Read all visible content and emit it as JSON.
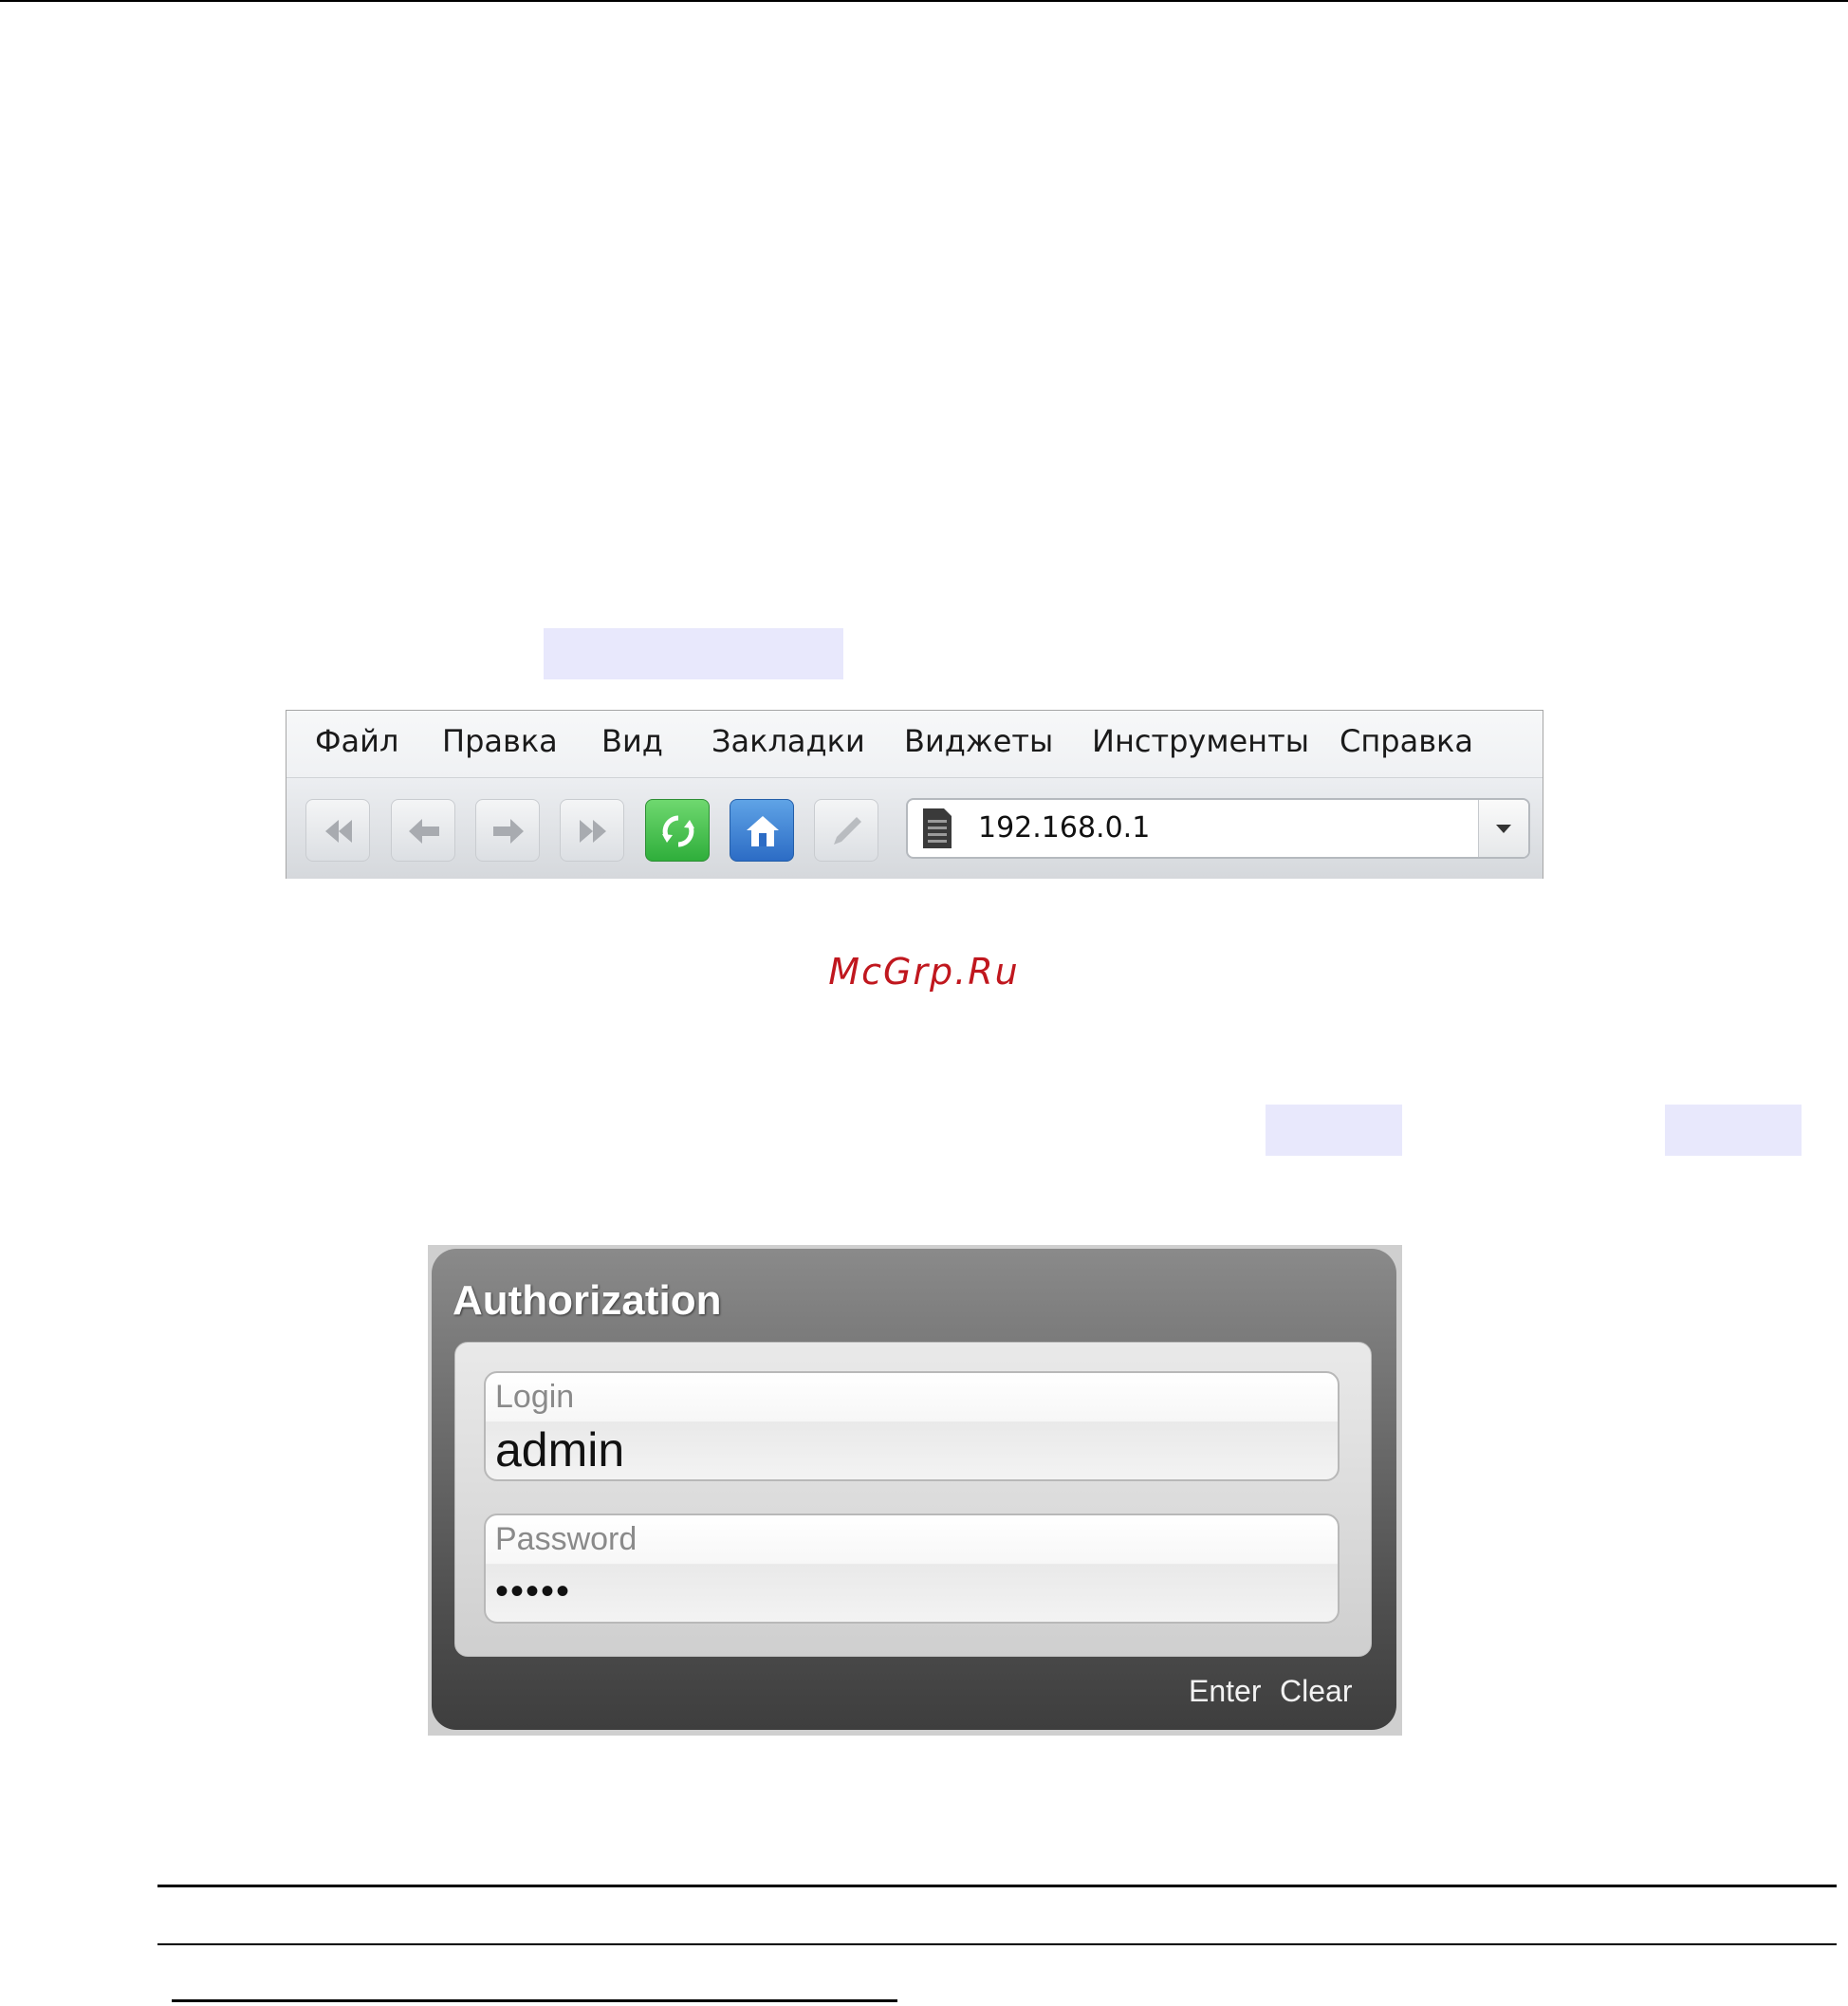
{
  "browser": {
    "menu": [
      "Файл",
      "Правка",
      "Вид",
      "Закладки",
      "Виджеты",
      "Инструменты",
      "Справка"
    ],
    "address": "192.168.0.1",
    "icons": [
      "rewind-icon",
      "back-icon",
      "forward-icon",
      "fast-forward-icon",
      "reload-icon",
      "home-icon",
      "pen-icon",
      "page-icon",
      "dropdown-arrow-icon"
    ]
  },
  "watermark": "McGrp.Ru",
  "auth": {
    "title": "Authorization",
    "login_label": "Login",
    "login_value": "admin",
    "password_label": "Password",
    "password_value": "•••••",
    "enter_label": "Enter",
    "clear_label": "Clear"
  },
  "colors": {
    "highlight": "#e8e8fc",
    "watermark": "#c0171e",
    "reload": "#2fae3b",
    "home": "#2c6cc5"
  }
}
